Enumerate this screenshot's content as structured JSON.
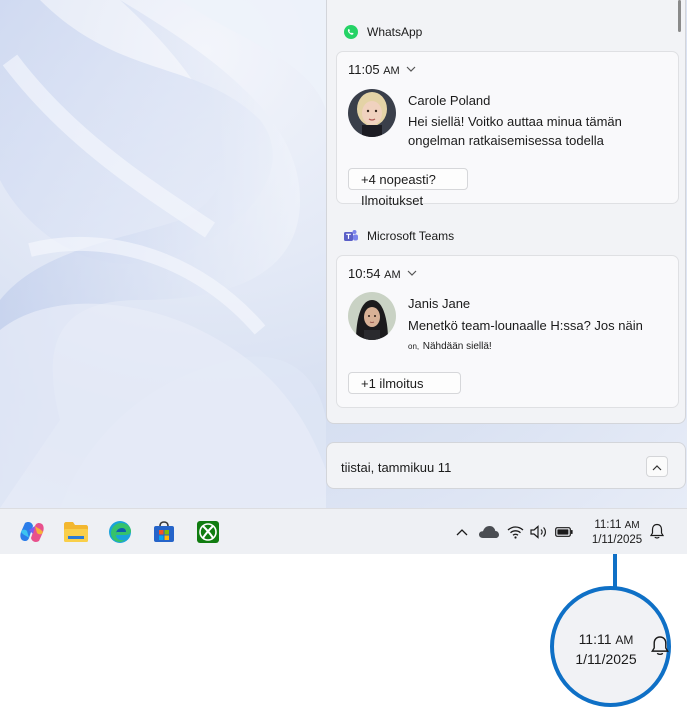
{
  "notifications": [
    {
      "app": "WhatsApp",
      "time": "11:05",
      "ampm": "AM",
      "sender": "Carole Poland",
      "message": "Hei siellä! Voitko auttaa minua tämän ongelman ratkaisemisessa todella",
      "more": "+4 nopeasti? Ilmoitukset",
      "accent": "#25d366"
    },
    {
      "app": "Microsoft Teams",
      "time": "10:54",
      "ampm": "AM",
      "sender": "Janis Jane",
      "message": "Menetkö team-lounaalle H:ssa? Jos näin",
      "message_tail_small": "on,",
      "message_tail": "Nähdään siellä!",
      "more": "+1 ilmoitus",
      "accent": "#5b5fc7"
    }
  ],
  "calendar": {
    "date": "tiistai, tammikuu 11"
  },
  "taskbar": {
    "apps": [
      "copilot-icon",
      "file-explorer-icon",
      "edge-icon",
      "store-icon",
      "xbox-icon"
    ],
    "tray": [
      "chevron-up-icon",
      "cloud-icon",
      "wifi-icon",
      "volume-icon",
      "battery-icon"
    ],
    "clock_time": "11:11",
    "clock_ampm": "AM",
    "clock_date": "1/11/2025"
  },
  "callout": {
    "time": "11:11",
    "ampm": "AM",
    "date": "1/11/2025",
    "color": "#0f70c6"
  }
}
